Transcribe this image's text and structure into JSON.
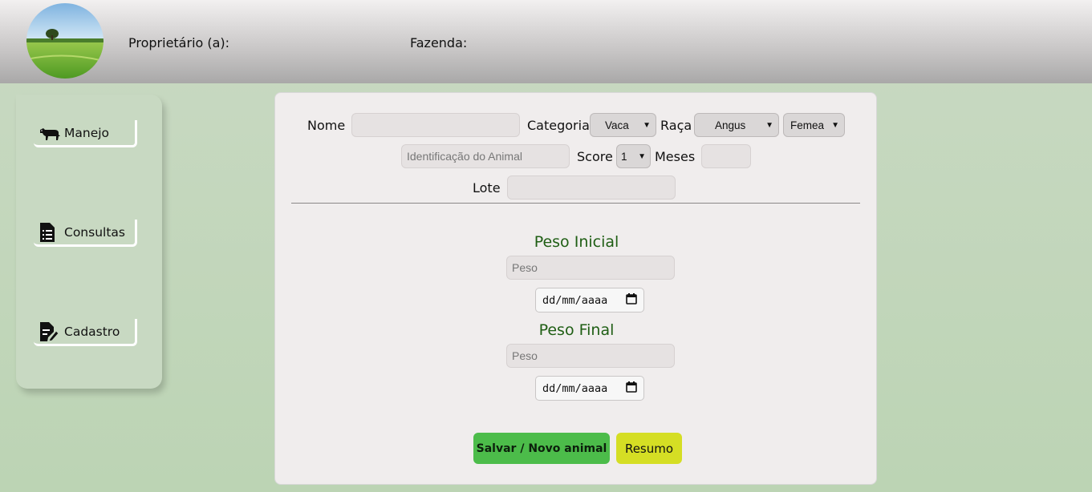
{
  "header": {
    "owner_label": "Proprietário (a):",
    "farm_label": "Fazenda:",
    "logo_icon": "farm-landscape-logo"
  },
  "sidebar": {
    "items": [
      {
        "label": "Manejo",
        "icon": "cow-icon"
      },
      {
        "label": "Consultas",
        "icon": "document-list-icon"
      },
      {
        "label": "Cadastro",
        "icon": "document-edit-icon"
      }
    ]
  },
  "form": {
    "nome_label": "Nome",
    "nome_value": "",
    "categoria_label": "Categoria",
    "categoria_value": "Vaca",
    "raca_label": "Raça",
    "raca_value": "Angus",
    "sexo_value": "Femea",
    "identificacao_placeholder": "Identificação do Animal",
    "score_label": "Score",
    "score_value": "1",
    "meses_label": "Meses",
    "meses_value": "",
    "lote_label": "Lote",
    "lote_value": ""
  },
  "peso_inicial": {
    "title": "Peso Inicial",
    "peso_placeholder": "Peso",
    "date_placeholder": "dd/mm/aaaa"
  },
  "peso_final": {
    "title": "Peso Final",
    "peso_placeholder": "Peso",
    "date_placeholder": "dd/mm/aaaa"
  },
  "actions": {
    "save_label": "Salvar / Novo animal",
    "summary_label": "Resumo"
  },
  "colors": {
    "save_button": "#4cbc4a",
    "summary_button": "#d5de24",
    "section_title": "#1f5e14",
    "background": "#c4d6bd"
  }
}
